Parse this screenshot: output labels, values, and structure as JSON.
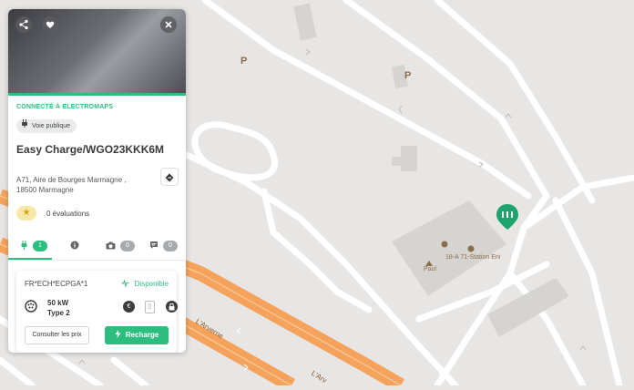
{
  "map": {
    "parking_labels": [
      "P",
      "P"
    ],
    "poi_labels": [
      "Paul",
      "18-A 71-Station Eni"
    ],
    "road_labels": [
      "L'Arverne",
      "L'Arv"
    ],
    "marker_icon": "ev-charger-pin-icon"
  },
  "panel": {
    "header_buttons": [
      "share-icon",
      "heart-icon",
      "close-icon"
    ],
    "connected_label": "CONNECTÉ À ELECTROMAPS",
    "tag_label": "Voie publique",
    "title": "Easy Charge/WGO23KKK6M",
    "address_line1": "A71, Aire de Bourges Marmagne ,",
    "address_line2": "18500 Marmagne",
    "reviews_label": "0 évaluations",
    "tabs": [
      {
        "icon": "plug-icon",
        "count": "1"
      },
      {
        "icon": "info-icon",
        "count": ""
      },
      {
        "icon": "camera-icon",
        "count": "0"
      },
      {
        "icon": "comment-icon",
        "count": "0"
      }
    ],
    "connector": {
      "id": "FR*ECH*ECPGA*1",
      "status": "Disponible",
      "power": "50 kW",
      "type": "Type 2",
      "prices_button": "Consulter les prix",
      "charge_button": "Recharge"
    },
    "colors": {
      "accent": "#2dbd7f",
      "road": "#f5a35c"
    }
  }
}
